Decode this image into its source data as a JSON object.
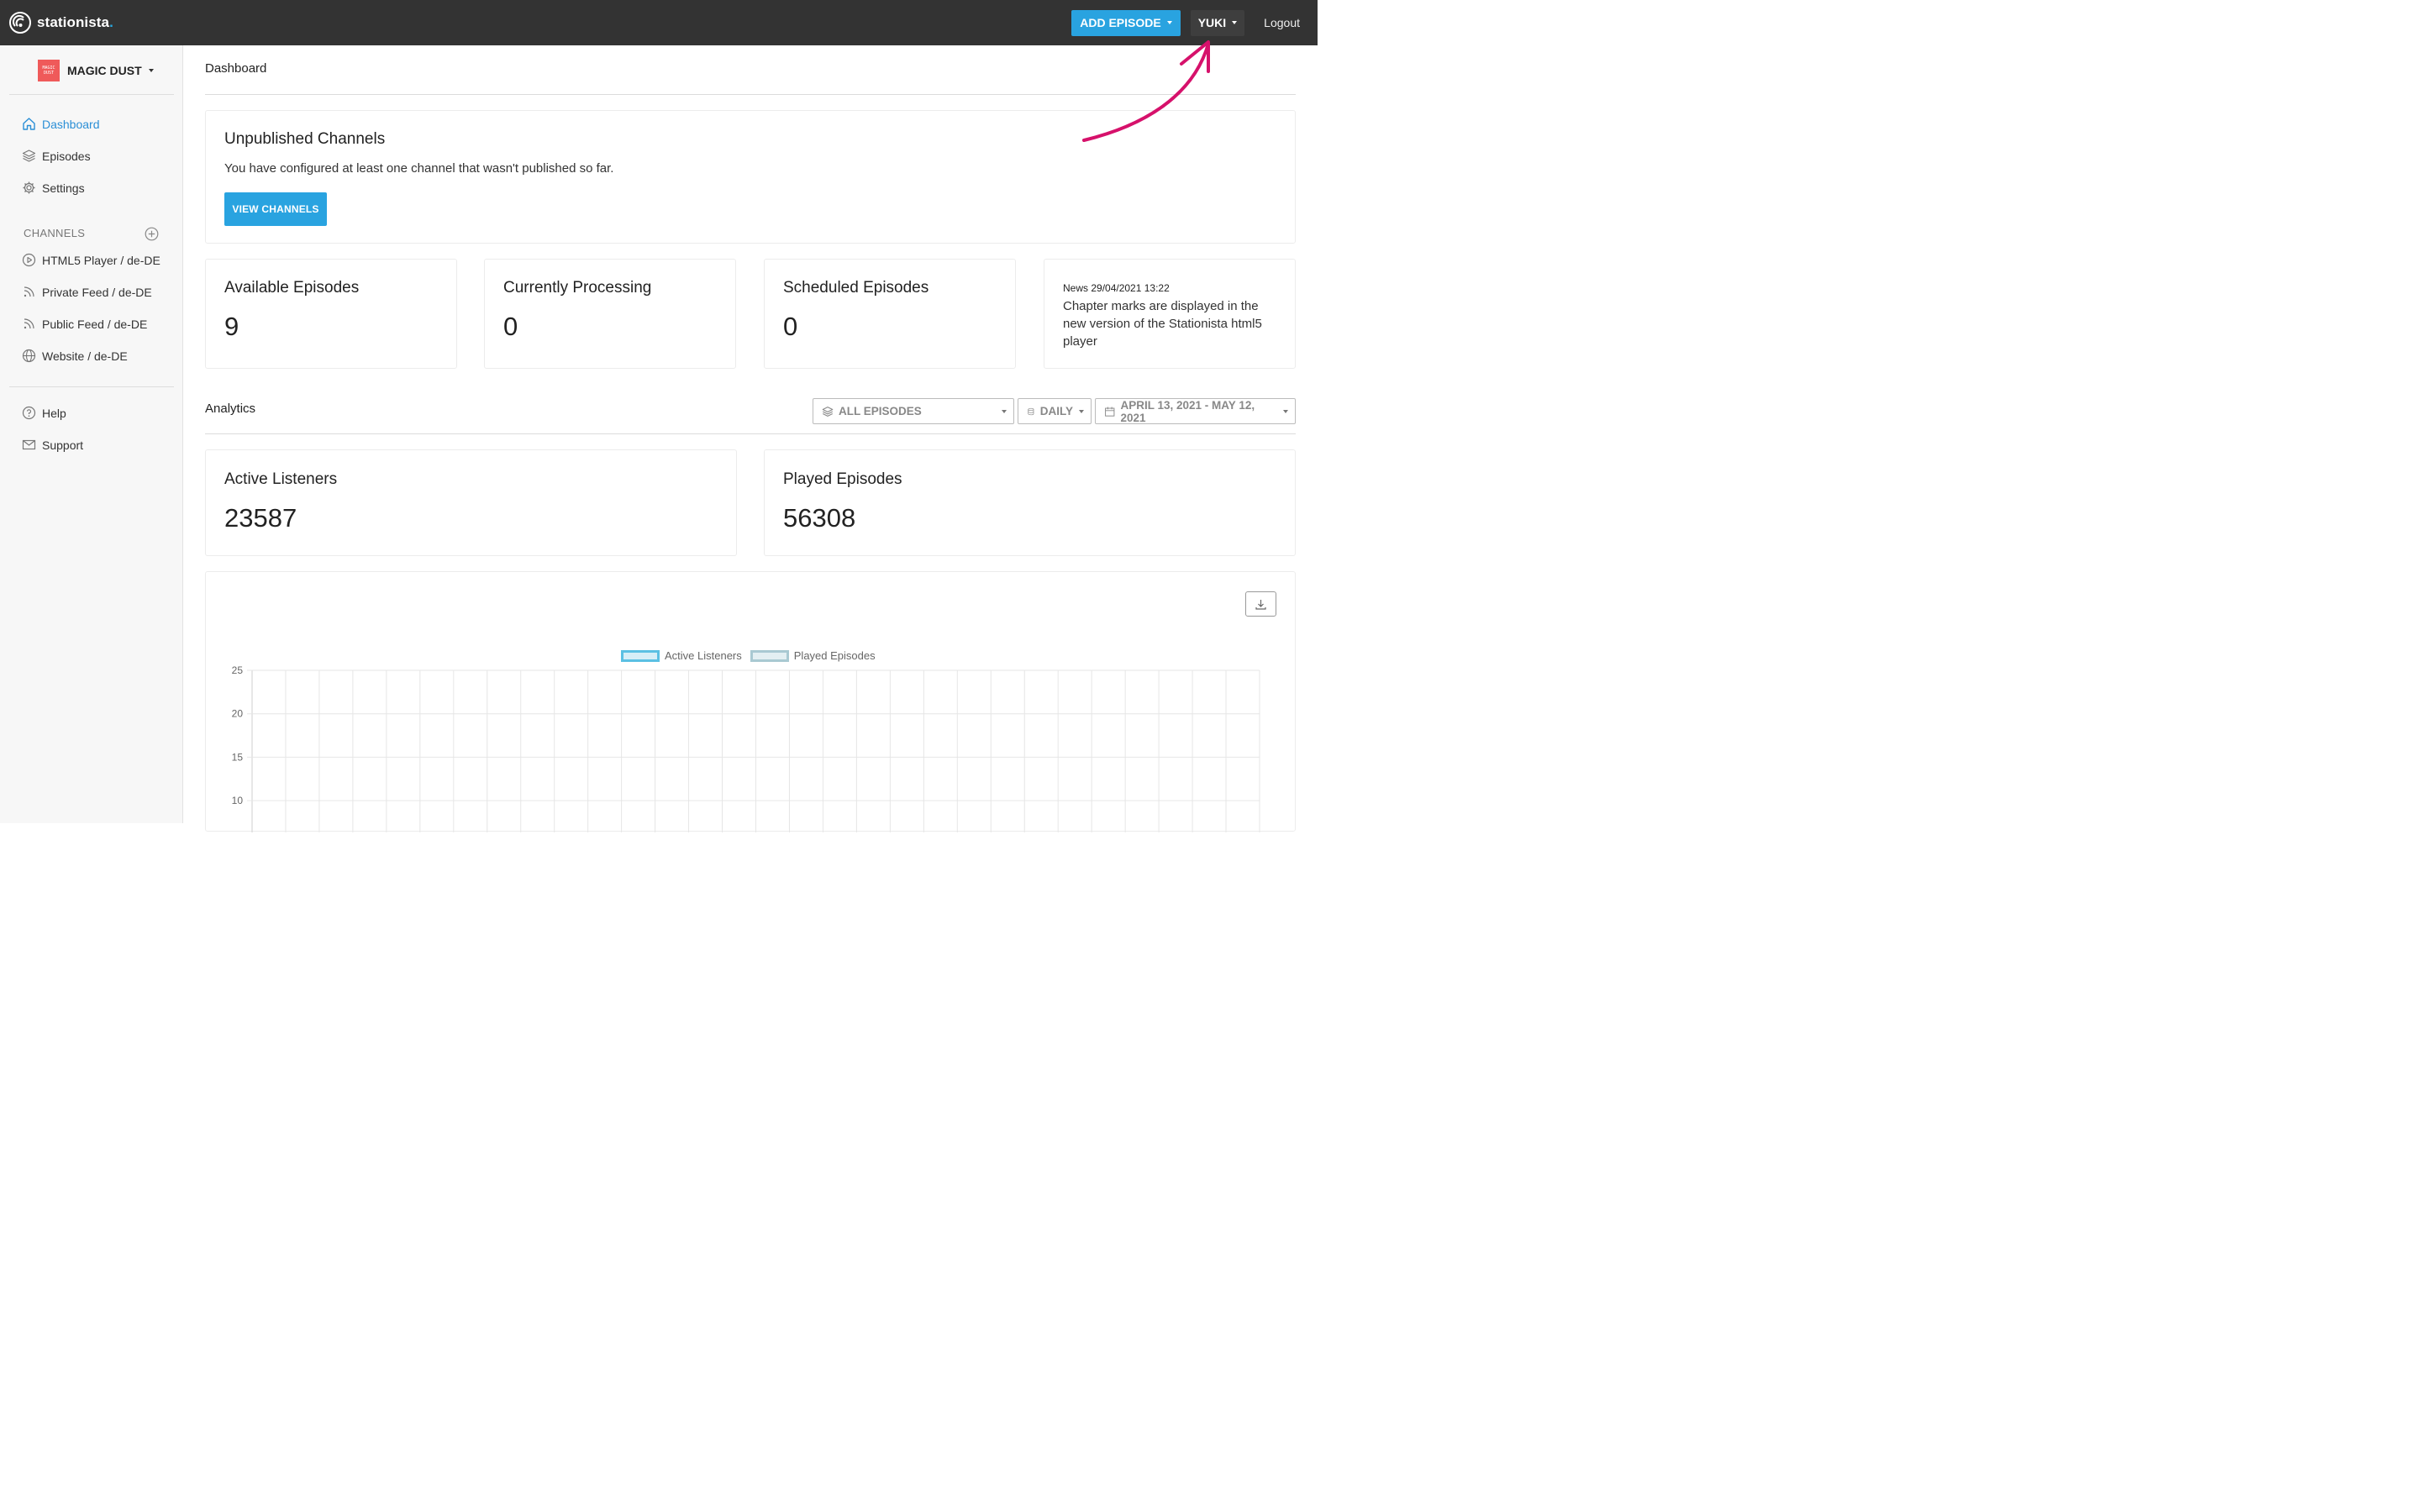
{
  "brand": {
    "name": "stationista",
    "dot": "."
  },
  "topbar": {
    "add_episode_label": "ADD EPISODE",
    "user_label": "YUKI",
    "logout_label": "Logout"
  },
  "sidebar": {
    "channel_thumb_line1": "MAGIC",
    "channel_thumb_line2": "DUST",
    "channel_name": "MAGIC DUST",
    "nav": [
      {
        "label": "Dashboard",
        "icon": "home-icon"
      },
      {
        "label": "Episodes",
        "icon": "layers-icon"
      },
      {
        "label": "Settings",
        "icon": "gear-icon"
      }
    ],
    "channels_heading": "CHANNELS",
    "channels": [
      {
        "label": "HTML5 Player / de-DE",
        "icon": "play-icon"
      },
      {
        "label": "Private Feed / de-DE",
        "icon": "rss-icon"
      },
      {
        "label": "Public Feed / de-DE",
        "icon": "rss-icon"
      },
      {
        "label": "Website / de-DE",
        "icon": "globe-icon"
      }
    ],
    "footer": [
      {
        "label": "Help",
        "icon": "help-icon"
      },
      {
        "label": "Support",
        "icon": "mail-icon"
      }
    ]
  },
  "main": {
    "page_title": "Dashboard",
    "unpublished": {
      "title": "Unpublished Channels",
      "text": "You have configured at least one channel that wasn't published so far.",
      "button": "VIEW CHANNELS"
    },
    "stats": [
      {
        "title": "Available Episodes",
        "value": "9"
      },
      {
        "title": "Currently Processing",
        "value": "0"
      },
      {
        "title": "Scheduled Episodes",
        "value": "0"
      }
    ],
    "news": {
      "date": "News 29/04/2021 13:22",
      "text": "Chapter marks are displayed in the new version of the Stationista html5 player"
    },
    "analytics": {
      "title": "Analytics",
      "filter_episodes": "ALL EPISODES",
      "filter_interval": "DAILY",
      "filter_range": "APRIL 13, 2021 - MAY 12, 2021",
      "active_listeners_title": "Active Listeners",
      "active_listeners_value": "23587",
      "played_episodes_title": "Played Episodes",
      "played_episodes_value": "56308"
    }
  },
  "chart_data": {
    "type": "line",
    "series": [
      {
        "name": "Active Listeners",
        "values": []
      },
      {
        "name": "Played Episodes",
        "values": []
      }
    ],
    "y_ticks": [
      "25",
      "20",
      "15",
      "10"
    ],
    "ylim": [
      10,
      25
    ],
    "grid": true,
    "legend": "top-center",
    "colors": {
      "active_listeners": "#5bc0e3",
      "played_episodes": "#a9c9d2"
    }
  },
  "colors": {
    "accent": "#29a3e0",
    "topbar": "#333333",
    "arrow": "#d6116b"
  }
}
